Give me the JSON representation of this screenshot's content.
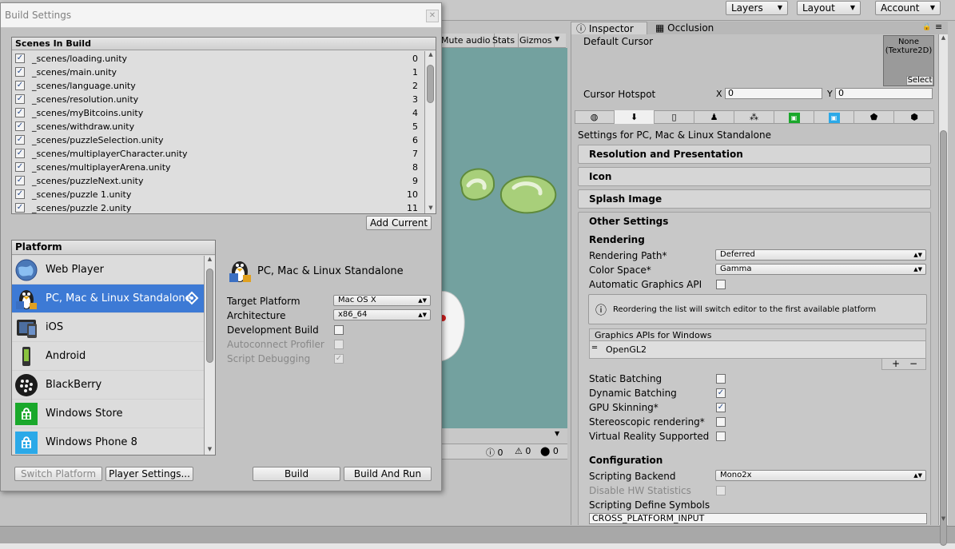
{
  "top_bar": {
    "layers_label": "Layers",
    "layout_label": "Layout",
    "account_label": "Account"
  },
  "scene_view": {
    "mute_audio": "Mute audio",
    "stats": "Stats",
    "gizmos": "Gizmos",
    "console_counts": [
      "0",
      "0",
      "0"
    ]
  },
  "build_settings": {
    "title": "Build Settings",
    "scenes_header": "Scenes In Build",
    "scenes": [
      {
        "name": "_scenes/loading.unity",
        "index": "0"
      },
      {
        "name": "_scenes/main.unity",
        "index": "1"
      },
      {
        "name": "_scenes/language.unity",
        "index": "2"
      },
      {
        "name": "_scenes/resolution.unity",
        "index": "3"
      },
      {
        "name": "_scenes/myBitcoins.unity",
        "index": "4"
      },
      {
        "name": "_scenes/withdraw.unity",
        "index": "5"
      },
      {
        "name": "_scenes/puzzleSelection.unity",
        "index": "6"
      },
      {
        "name": "_scenes/multiplayerCharacter.unity",
        "index": "7"
      },
      {
        "name": "_scenes/multiplayerArena.unity",
        "index": "8"
      },
      {
        "name": "_scenes/puzzleNext.unity",
        "index": "9"
      },
      {
        "name": "_scenes/puzzle 1.unity",
        "index": "10"
      },
      {
        "name": "_scenes/puzzle 2.unity",
        "index": "11"
      }
    ],
    "add_current_label": "Add Current",
    "platform_header": "Platform",
    "platforms": [
      {
        "label": "Web Player",
        "icon": "globe-icon"
      },
      {
        "label": "PC, Mac & Linux Standalone",
        "icon": "linux-penguin-icon",
        "selected": true
      },
      {
        "label": "iOS",
        "icon": "ios-device-icon"
      },
      {
        "label": "Android",
        "icon": "android-icon"
      },
      {
        "label": "BlackBerry",
        "icon": "blackberry-icon"
      },
      {
        "label": "Windows Store",
        "icon": "windows-store-icon"
      },
      {
        "label": "Windows Phone 8",
        "icon": "windows-phone-icon"
      }
    ],
    "selected_platform_title": "PC, Mac & Linux Standalone",
    "target_platform_label": "Target Platform",
    "target_platform_value": "Mac OS X",
    "architecture_label": "Architecture",
    "architecture_value": "x86_64",
    "development_build_label": "Development Build",
    "autoconnect_profiler_label": "Autoconnect Profiler",
    "script_debugging_label": "Script Debugging",
    "switch_platform_label": "Switch Platform",
    "player_settings_label": "Player Settings...",
    "build_label": "Build",
    "build_and_run_label": "Build And Run"
  },
  "inspector": {
    "tab_inspector": "Inspector",
    "tab_occlusion": "Occlusion",
    "default_cursor_label": "Default Cursor",
    "cursor_texture_value": "None\n(Texture2D)",
    "select_label": "Select",
    "cursor_hotspot_label": "Cursor Hotspot",
    "hotspot_x_label": "X",
    "hotspot_x_value": "0",
    "hotspot_y_label": "Y",
    "hotspot_y_value": "0",
    "settings_for": "Settings for PC, Mac & Linux Standalone",
    "foldouts": {
      "resolution": "Resolution and Presentation",
      "icon": "Icon",
      "splash": "Splash Image",
      "other": "Other Settings"
    },
    "rendering_header": "Rendering",
    "rendering_path_label": "Rendering Path*",
    "rendering_path_value": "Deferred",
    "color_space_label": "Color Space*",
    "color_space_value": "Gamma",
    "auto_graphics_api_label": "Automatic Graphics API",
    "info_message": "Reordering the list will switch editor to the first available platform",
    "graphics_apis_header": "Graphics APIs for Windows",
    "graphics_api_item": "OpenGL2",
    "add_remove": [
      "+",
      "−"
    ],
    "static_batching_label": "Static Batching",
    "dynamic_batching_label": "Dynamic Batching",
    "gpu_skinning_label": "GPU Skinning*",
    "stereoscopic_label": "Stereoscopic rendering*",
    "vr_supported_label": "Virtual Reality Supported",
    "configuration_header": "Configuration",
    "scripting_backend_label": "Scripting Backend",
    "scripting_backend_value": "Mono2x",
    "disable_hw_stats_label": "Disable HW Statistics",
    "define_symbols_label": "Scripting Define Symbols",
    "define_symbols_value": "CROSS_PLATFORM_INPUT"
  },
  "colors": {
    "selection_blue": "#3d7ad5",
    "scene_teal": "#73a19f",
    "panel_gray": "#c2c2c2"
  }
}
